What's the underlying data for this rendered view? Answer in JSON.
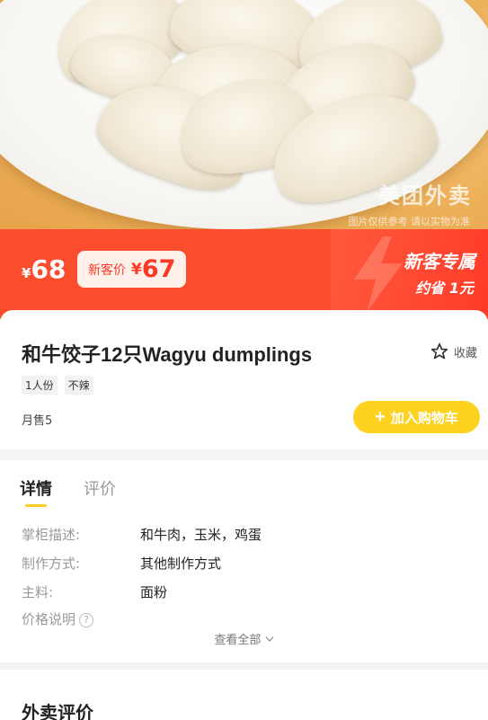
{
  "hero": {
    "watermark": "美团外卖",
    "watermark_note": "图片仅供参考 请以实物为准"
  },
  "price": {
    "currency": "¥",
    "original": "68",
    "new_label": "新客价",
    "new_price": "67"
  },
  "promo": {
    "title": "新客专属",
    "subtitle": "约省 1元"
  },
  "product": {
    "title": "和牛饺子12只Wagyu dumplings",
    "favorite_label": "收藏",
    "tags": [
      "1人份",
      "不辣"
    ],
    "sales": "月售5",
    "add_to_cart": "加入购物车"
  },
  "details": {
    "tabs": [
      "详情",
      "评价"
    ],
    "rows": [
      {
        "key": "掌柜描述:",
        "value": "和牛肉，玉米，鸡蛋"
      },
      {
        "key": "制作方式:",
        "value": "其他制作方式"
      },
      {
        "key": "主料:",
        "value": "面粉"
      },
      {
        "key": "价格说明",
        "value": ""
      }
    ],
    "see_all": "查看全部"
  },
  "reviews": {
    "title": "外卖评价"
  },
  "colors": {
    "price_red": "#fb4c2d",
    "cart_yellow": "#ffd21f",
    "tab_underline": "#ffcc22"
  }
}
